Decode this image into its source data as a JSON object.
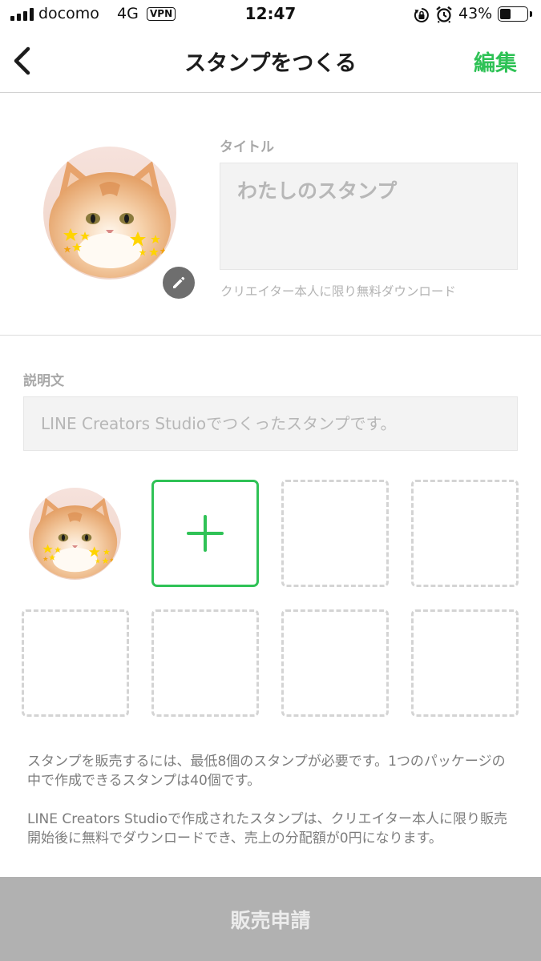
{
  "status_bar": {
    "carrier": "docomo",
    "network": "4G",
    "vpn": "VPN",
    "time": "12:47",
    "battery_percent": "43%",
    "battery_level": 0.43,
    "icons": [
      "signal-icon",
      "rotation-lock-icon",
      "alarm-icon",
      "battery-icon"
    ]
  },
  "nav": {
    "back_icon": "chevron-left-icon",
    "title": "スタンプをつくる",
    "edit_label": "編集"
  },
  "main_stamp": {
    "title_label": "タイトル",
    "title_placeholder": "わたしのスタンプ",
    "title_note": "クリエイター本人に限り無料ダウンロード",
    "edit_icon": "pencil-icon"
  },
  "description": {
    "label": "説明文",
    "placeholder": "LINE Creators Studioでつくったスタンプです。"
  },
  "stamp_grid": {
    "filled_count": 1,
    "add_icon": "plus-icon",
    "total_slots": 8
  },
  "notes": [
    "スタンプを販売するには、最低8個のスタンプが必要です。1つのパッケージの中で作成できるスタンプは40個です。",
    "LINE Creators Studioで作成されたスタンプは、クリエイター本人に限り販売開始後に無料でダウンロードでき、売上の分配額が0円になります。"
  ],
  "footer": {
    "submit_label": "販売申請"
  },
  "colors": {
    "accent": "#2fc256",
    "disabled_button": "#b1b1b1",
    "input_bg": "#f3f3f3"
  }
}
